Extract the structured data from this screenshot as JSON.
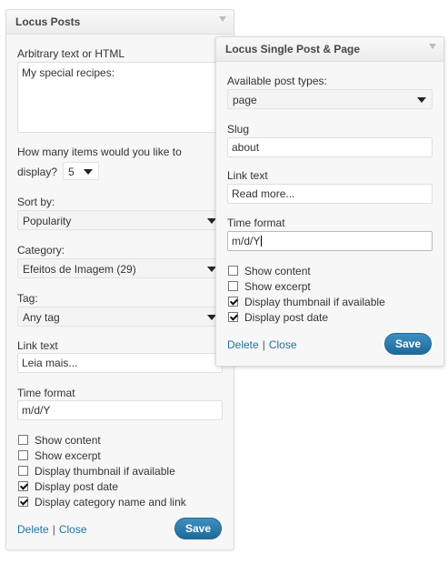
{
  "posts_widget": {
    "title": "Locus Posts",
    "text_label": "Arbitrary text or HTML",
    "text_value": "My special recipes:",
    "items_label_line1": "How many items would you like to",
    "items_label_line2": "display?",
    "items_value": "5",
    "sort_label": "Sort by:",
    "sort_value": "Popularity",
    "category_label": "Category:",
    "category_value": "Efeitos de Imagem (29)",
    "tag_label": "Tag:",
    "tag_value": "Any tag",
    "link_text_label": "Link text",
    "link_text_value": "Leia mais...",
    "time_format_label": "Time format",
    "time_format_value": "m/d/Y",
    "checkboxes": [
      {
        "label": "Show content",
        "checked": false
      },
      {
        "label": "Show excerpt",
        "checked": false
      },
      {
        "label": "Display thumbnail if available",
        "checked": false
      },
      {
        "label": "Display post date",
        "checked": true
      },
      {
        "label": "Display category name and link",
        "checked": true
      }
    ],
    "delete_label": "Delete",
    "separator": "|",
    "close_label": "Close",
    "save_label": "Save"
  },
  "single_widget": {
    "title": "Locus Single Post & Page",
    "post_types_label": "Available post types:",
    "post_types_value": "page",
    "slug_label": "Slug",
    "slug_value": "about",
    "link_text_label": "Link text",
    "link_text_value": "Read more...",
    "time_format_label": "Time format",
    "time_format_value": "m/d/Y",
    "checkboxes": [
      {
        "label": "Show content",
        "checked": false
      },
      {
        "label": "Show excerpt",
        "checked": false
      },
      {
        "label": "Display thumbnail if available",
        "checked": true
      },
      {
        "label": "Display post date",
        "checked": true
      }
    ],
    "delete_label": "Delete",
    "separator": "|",
    "close_label": "Close",
    "save_label": "Save"
  }
}
